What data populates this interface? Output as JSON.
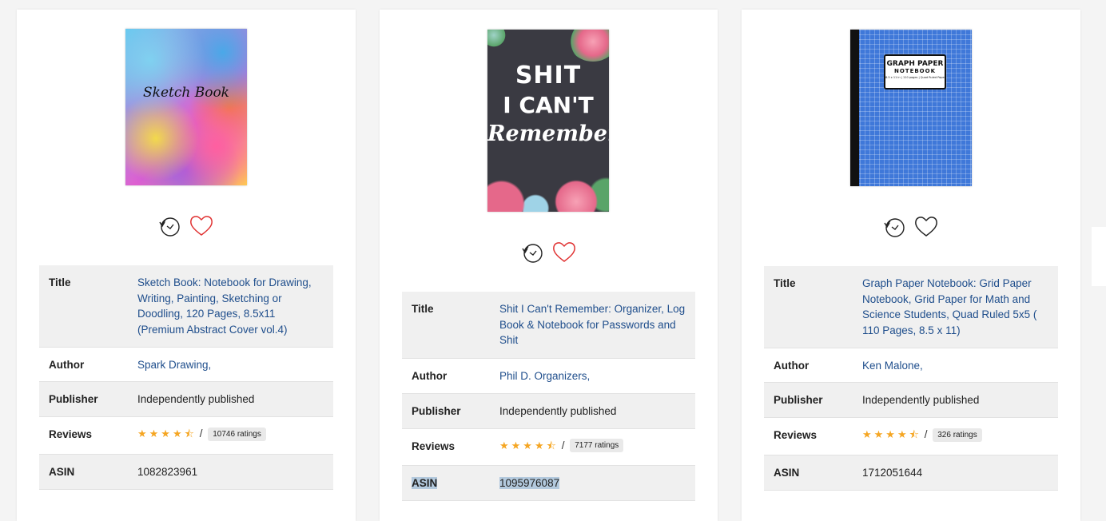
{
  "colors": {
    "link": "#1f4e8c",
    "star": "#f5a623",
    "heart_red": "#e03131",
    "heart_dark": "#222222",
    "highlight": "#b3c9dd"
  },
  "labels": {
    "title": "Title",
    "author": "Author",
    "publisher": "Publisher",
    "reviews": "Reviews",
    "asin": "ASIN"
  },
  "books": [
    {
      "cover_text": "Sketch Book",
      "title": "Sketch Book: Notebook for Drawing, Writing, Painting, Sketching or Doodling, 120 Pages, 8.5x11 (Premium Abstract Cover vol.4)",
      "author": "Spark Drawing,",
      "publisher": "Independently published",
      "rating": 4.5,
      "stars": "★★★★⯪",
      "slash": "/",
      "ratings_count": "10746 ratings",
      "asin": "1082823961",
      "heart_color": "red"
    },
    {
      "cover_text_1": "SHIT",
      "cover_text_2": "I CAN'T",
      "cover_text_3": "Remember",
      "title": "Shit I Can't Remember: Organizer, Log Book & Notebook for Passwords and Shit",
      "author": "Phil D. Organizers,",
      "publisher": "Independently published",
      "rating": 4.5,
      "stars": "★★★★⯪",
      "slash": "/",
      "ratings_count": "7177 ratings",
      "asin": "1095976087",
      "heart_color": "red"
    },
    {
      "cover_text_1": "GRAPH PAPER",
      "cover_text_2": "NOTEBOOK",
      "cover_text_3": "8.5 x 11 in | 110 pages | Quad Ruled Paper",
      "title": "Graph Paper Notebook: Grid Paper Notebook, Grid Paper for Math and Science Students, Quad Ruled 5x5 ( 110 Pages, 8.5 x 11)",
      "author": "Ken Malone,",
      "publisher": "Independently published",
      "rating": 4.5,
      "stars": "★★★★⯪",
      "slash": "/",
      "ratings_count": "326 ratings",
      "asin": "1712051644",
      "heart_color": "dark"
    }
  ]
}
